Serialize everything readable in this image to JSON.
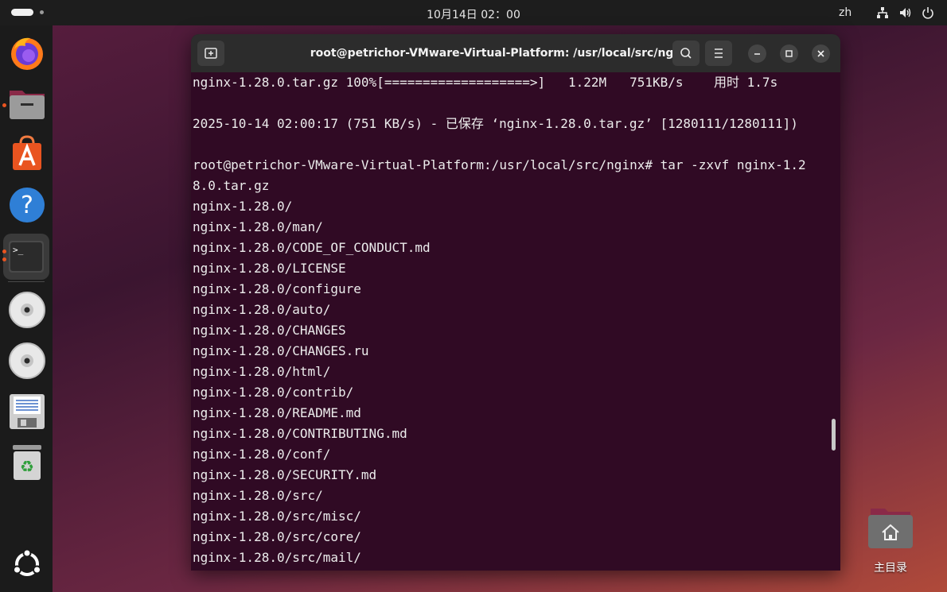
{
  "topbar": {
    "clock": "10月14日  02：00",
    "language": "zh"
  },
  "dock": {
    "items": [
      {
        "name": "firefox-icon"
      },
      {
        "name": "files-icon"
      },
      {
        "name": "app-center-icon"
      },
      {
        "name": "help-icon"
      },
      {
        "name": "terminal-icon"
      },
      {
        "name": "disc-icon"
      },
      {
        "name": "disc-icon"
      },
      {
        "name": "floppy-save-icon"
      },
      {
        "name": "trash-icon"
      },
      {
        "name": "ubuntu-apps-icon"
      }
    ]
  },
  "terminal": {
    "title": "root@petrichor-VMware-Virtual-Platform: /usr/local/src/nginx",
    "lines": [
      "nginx-1.28.0.tar.gz 100%[===================>]   1.22M   751KB/s    用时 1.7s",
      "",
      "2025-10-14 02:00:17 (751 KB/s) - 已保存 ‘nginx-1.28.0.tar.gz’ [1280111/1280111])",
      "",
      "root@petrichor-VMware-Virtual-Platform:/usr/local/src/nginx# tar -zxvf nginx-1.2",
      "8.0.tar.gz",
      "nginx-1.28.0/",
      "nginx-1.28.0/man/",
      "nginx-1.28.0/CODE_OF_CONDUCT.md",
      "nginx-1.28.0/LICENSE",
      "nginx-1.28.0/configure",
      "nginx-1.28.0/auto/",
      "nginx-1.28.0/CHANGES",
      "nginx-1.28.0/CHANGES.ru",
      "nginx-1.28.0/html/",
      "nginx-1.28.0/contrib/",
      "nginx-1.28.0/README.md",
      "nginx-1.28.0/CONTRIBUTING.md",
      "nginx-1.28.0/conf/",
      "nginx-1.28.0/SECURITY.md",
      "nginx-1.28.0/src/",
      "nginx-1.28.0/src/misc/",
      "nginx-1.28.0/src/core/",
      "nginx-1.28.0/src/mail/"
    ]
  },
  "desktop": {
    "home_label": "主目录"
  },
  "colors": {
    "terminal_bg": "#300a24",
    "accent": "#e95420"
  }
}
